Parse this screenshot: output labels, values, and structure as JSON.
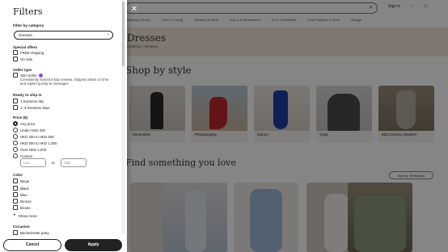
{
  "filters": {
    "title": "Filters",
    "category_label": "Filter by category",
    "category_value": "Dresses",
    "special_offers": {
      "label": "Special offers",
      "options": [
        "FREE shipping",
        "On sale"
      ]
    },
    "seller_type": {
      "label": "Seller type",
      "option": "Star Seller",
      "description": "Consistently earned 5-star reviews, shipped orders on time, and replied quickly to messages"
    },
    "ready_to_ship": {
      "label": "Ready to ship in",
      "options": [
        "1 business day",
        "1–3 business days"
      ]
    },
    "price": {
      "label": "Price ($)",
      "options": [
        "Any price",
        "Under HKD 200",
        "HKD 200 to HKD 500",
        "HKD 500 to HKD 1,000",
        "Over HKD 1,000",
        "Custom"
      ],
      "selected": "Any price",
      "low_placeholder": "Low",
      "to": "to",
      "high_placeholder": "High"
    },
    "color": {
      "label": "Color",
      "options": [
        "Beige",
        "Black",
        "Blue",
        "Bronze",
        "Brown"
      ],
      "show_more": "Show more"
    },
    "occasion": {
      "label": "Occasion",
      "first_option": "Bachelorette party"
    },
    "cancel_label": "Cancel",
    "apply_label": "Apply"
  },
  "background": {
    "search_placeholder": "Search for anything",
    "signin": "Sign in",
    "nav": [
      "Clothing & Shoes",
      "Home & Living",
      "Wedding & Party",
      "Toys & Entertainment",
      "Art & Collectibles",
      "Craft Supplies & Tools",
      "Vintage"
    ],
    "hero_title": "Dresses",
    "breadcrumb": "Clothing > Dresses",
    "section_heading": "Shop by style",
    "style_cards": [
      "Minimalist",
      "Photography",
      "Dance",
      "Yoga",
      "Mid Century Modern"
    ],
    "love_heading": "Find something you love",
    "sort_label": "Sort by: Relevancy"
  },
  "colors": {
    "accent_purple": "#8f4ad1",
    "hero_bg": "#f4e7d9",
    "button_dark": "#222222"
  }
}
